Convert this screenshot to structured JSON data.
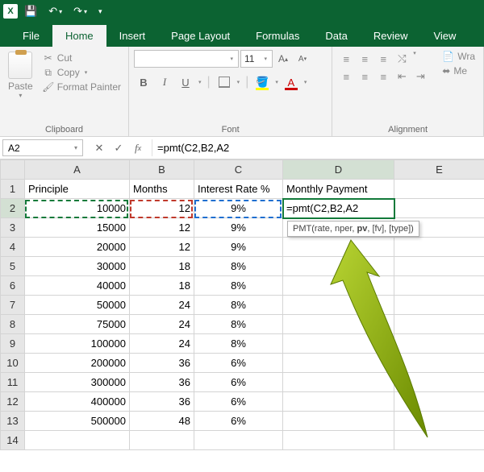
{
  "titlebar": {
    "app": "X"
  },
  "tabs": {
    "file": "File",
    "home": "Home",
    "insert": "Insert",
    "page_layout": "Page Layout",
    "formulas": "Formulas",
    "data": "Data",
    "review": "Review",
    "view": "View"
  },
  "clipboard": {
    "label": "Clipboard",
    "paste": "Paste",
    "cut": "Cut",
    "copy": "Copy",
    "format_painter": "Format Painter"
  },
  "font": {
    "label": "Font",
    "name": "",
    "size": "11",
    "grow": "A",
    "shrink": "A",
    "bold": "B",
    "italic": "I",
    "underline": "U",
    "color_letter": "A"
  },
  "alignment": {
    "label": "Alignment",
    "wrap": "Wra",
    "merge": "Me"
  },
  "namebox": "A2",
  "formula": "=pmt(C2,B2,A2",
  "columns": [
    "A",
    "B",
    "C",
    "D",
    "E"
  ],
  "headers": {
    "A": "Principle",
    "B": "Months",
    "C": "Interest Rate %",
    "D": "Monthly Payment"
  },
  "rows": [
    {
      "n": 1
    },
    {
      "n": 2,
      "A": "10000",
      "B": "12",
      "C": "9%",
      "D": "=pmt(C2,B2,A2"
    },
    {
      "n": 3,
      "A": "15000",
      "B": "12",
      "C": "9%"
    },
    {
      "n": 4,
      "A": "20000",
      "B": "12",
      "C": "9%"
    },
    {
      "n": 5,
      "A": "30000",
      "B": "18",
      "C": "8%"
    },
    {
      "n": 6,
      "A": "40000",
      "B": "18",
      "C": "8%"
    },
    {
      "n": 7,
      "A": "50000",
      "B": "24",
      "C": "8%"
    },
    {
      "n": 8,
      "A": "75000",
      "B": "24",
      "C": "8%"
    },
    {
      "n": 9,
      "A": "100000",
      "B": "24",
      "C": "8%"
    },
    {
      "n": 10,
      "A": "200000",
      "B": "36",
      "C": "6%"
    },
    {
      "n": 11,
      "A": "300000",
      "B": "36",
      "C": "6%"
    },
    {
      "n": 12,
      "A": "400000",
      "B": "36",
      "C": "6%"
    },
    {
      "n": 13,
      "A": "500000",
      "B": "48",
      "C": "6%"
    },
    {
      "n": 14
    }
  ],
  "tooltip": {
    "fn": "PMT",
    "sig_pre": "(rate, nper, ",
    "sig_bold": "pv",
    "sig_post": ", [fv], [type])"
  }
}
